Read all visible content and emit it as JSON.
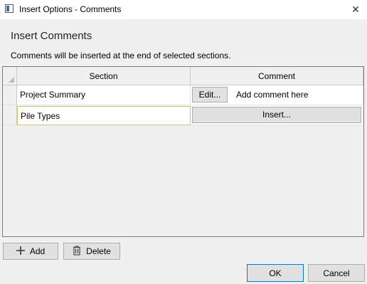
{
  "window": {
    "title": "Insert Options - Comments",
    "close_glyph": "✕"
  },
  "heading": "Insert Comments",
  "description": "Comments will be inserted at the end of selected sections.",
  "grid": {
    "columns": [
      "Section",
      "Comment"
    ],
    "rows": [
      {
        "section": "Project Summary",
        "edit_label": "Edit...",
        "comment": "Add comment here"
      },
      {
        "section": "Pile Types",
        "insert_label": "Insert..."
      }
    ]
  },
  "buttons": {
    "add": "Add",
    "delete": "Delete",
    "ok": "OK",
    "cancel": "Cancel"
  },
  "icons": {
    "app": "window-app-icon",
    "close": "close-icon",
    "add": "plus-icon",
    "delete": "trash-icon"
  },
  "colors": {
    "accent": "#0078d7",
    "selected_border": "#d7c47a"
  }
}
